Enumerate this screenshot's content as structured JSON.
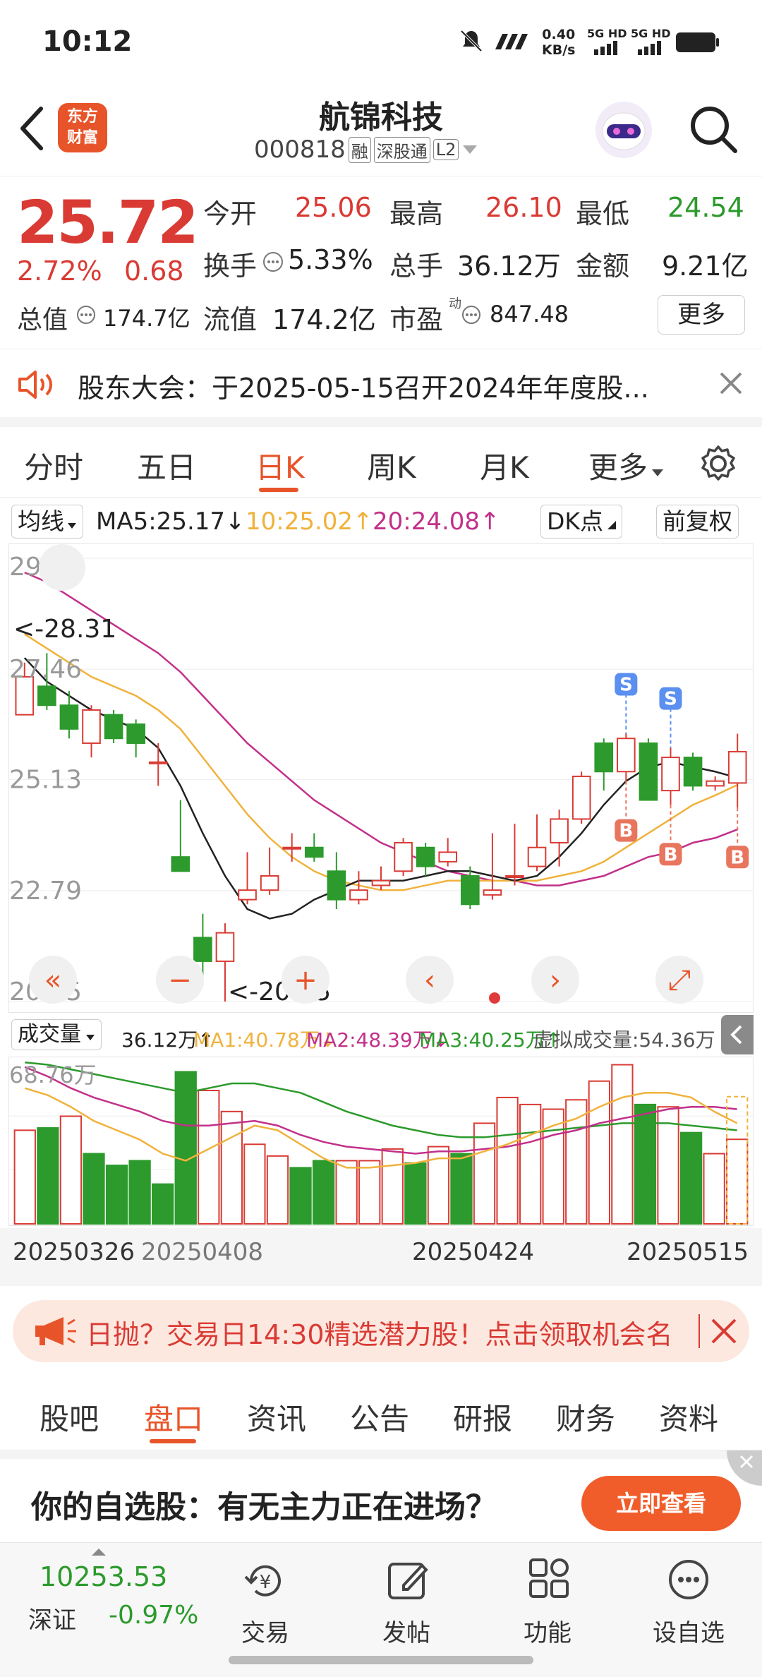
{
  "status": {
    "time": "10:12",
    "net_speed": "0.40",
    "net_unit": "KB/s",
    "sig1": "5G HD",
    "sig2": "5G HD"
  },
  "header": {
    "logo_line1": "东方",
    "logo_line2": "财富",
    "stock_name": "航锦科技",
    "stock_code": "000818",
    "tag1": "融",
    "tag2": "深股通",
    "tag3": "L2"
  },
  "quote": {
    "price": "25.72",
    "pct": "2.72%",
    "change": "0.68",
    "open_label": "今开",
    "open": "25.06",
    "high_label": "最高",
    "high": "26.10",
    "low_label": "最低",
    "low": "24.54",
    "turnover_label": "换手",
    "turnover": "5.33%",
    "volume_label": "总手",
    "volume": "36.12万",
    "amount_label": "金额",
    "amount": "9.21亿",
    "mcap_label": "总值",
    "mcap": "174.7亿",
    "float_label": "流值",
    "float": "174.2亿",
    "pe_label": "市盈",
    "pe_sup": "动",
    "pe": "847.48",
    "more": "更多"
  },
  "notice": {
    "text": "股东大会：于2025-05-15召开2024年年度股..."
  },
  "ktabs": [
    "分时",
    "五日",
    "日K",
    "周K",
    "月K",
    "更多"
  ],
  "ma": {
    "select": "均线",
    "ma5": "MA5:25.17",
    "ma10": "10:25.02",
    "ma20": "20:24.08",
    "dk": "DK点",
    "adjust": "前复权"
  },
  "colors": {
    "accent": "#e8542a",
    "up": "#d93b34",
    "down": "#2c9a2c",
    "ma5": "#222222",
    "ma10": "#f0b23c",
    "ma20": "#c2308a"
  },
  "chart_data": [
    {
      "type": "candlestick",
      "title": "日K",
      "y_ticks": [
        "29.80",
        "27.46",
        "25.13",
        "22.79",
        "20.45"
      ],
      "ylim": [
        20.45,
        29.8
      ],
      "annotations": [
        "<-28.31",
        "<-20.45"
      ],
      "x_labels": [
        "20250326",
        "20250408",
        "20250424",
        "20250515"
      ],
      "candles": [
        {
          "o": 26.5,
          "c": 27.3,
          "h": 27.6,
          "l": 26.5
        },
        {
          "o": 27.1,
          "c": 26.7,
          "h": 27.8,
          "l": 26.6
        },
        {
          "o": 26.7,
          "c": 26.2,
          "h": 27.0,
          "l": 26.0
        },
        {
          "o": 25.9,
          "c": 26.6,
          "h": 26.7,
          "l": 25.6
        },
        {
          "o": 26.5,
          "c": 26.0,
          "h": 26.6,
          "l": 25.9
        },
        {
          "o": 26.3,
          "c": 25.9,
          "h": 26.4,
          "l": 25.6
        },
        {
          "o": 25.5,
          "c": 25.5,
          "h": 25.9,
          "l": 25.0
        },
        {
          "o": 23.5,
          "c": 23.2,
          "h": 24.7,
          "l": 23.2
        },
        {
          "o": 21.8,
          "c": 21.3,
          "h": 22.3,
          "l": 20.8
        },
        {
          "o": 21.3,
          "c": 21.9,
          "h": 22.1,
          "l": 20.45
        },
        {
          "o": 22.6,
          "c": 22.8,
          "h": 23.6,
          "l": 22.5
        },
        {
          "o": 22.8,
          "c": 23.1,
          "h": 23.7,
          "l": 22.7
        },
        {
          "o": 23.7,
          "c": 23.7,
          "h": 24.0,
          "l": 23.4
        },
        {
          "o": 23.7,
          "c": 23.5,
          "h": 24.0,
          "l": 23.4
        },
        {
          "o": 23.2,
          "c": 22.6,
          "h": 23.6,
          "l": 22.4
        },
        {
          "o": 22.6,
          "c": 22.8,
          "h": 23.2,
          "l": 22.5
        },
        {
          "o": 22.9,
          "c": 23.0,
          "h": 23.3,
          "l": 22.8
        },
        {
          "o": 23.2,
          "c": 23.8,
          "h": 23.9,
          "l": 23.1
        },
        {
          "o": 23.7,
          "c": 23.3,
          "h": 23.8,
          "l": 23.1
        },
        {
          "o": 23.4,
          "c": 23.6,
          "h": 23.9,
          "l": 23.3
        },
        {
          "o": 23.1,
          "c": 22.5,
          "h": 23.3,
          "l": 22.4
        },
        {
          "o": 22.7,
          "c": 22.8,
          "h": 24.0,
          "l": 22.6
        },
        {
          "o": 23.1,
          "c": 23.1,
          "h": 24.2,
          "l": 22.9
        },
        {
          "o": 23.3,
          "c": 23.7,
          "h": 24.4,
          "l": 23.2
        },
        {
          "o": 23.8,
          "c": 24.3,
          "h": 24.5,
          "l": 23.3
        },
        {
          "o": 24.3,
          "c": 25.2,
          "h": 25.3,
          "l": 24.2
        },
        {
          "o": 25.9,
          "c": 25.3,
          "h": 26.0,
          "l": 24.9
        },
        {
          "o": 25.3,
          "c": 26.0,
          "h": 26.1,
          "l": 25.1
        },
        {
          "o": 25.9,
          "c": 24.7,
          "h": 26.0,
          "l": 24.7
        },
        {
          "o": 24.9,
          "c": 25.6,
          "h": 25.8,
          "l": 24.6
        },
        {
          "o": 25.6,
          "c": 25.0,
          "h": 25.7,
          "l": 24.9
        },
        {
          "o": 25.0,
          "c": 25.1,
          "h": 25.2,
          "l": 24.9
        },
        {
          "o": 25.06,
          "c": 25.72,
          "h": 26.1,
          "l": 24.54
        }
      ],
      "ma5": [
        27.7,
        27.2,
        26.9,
        26.6,
        26.4,
        26.2,
        25.8,
        25.0,
        24.0,
        23.1,
        22.4,
        22.2,
        22.3,
        22.6,
        22.8,
        23.0,
        23.0,
        23.0,
        23.1,
        23.2,
        23.2,
        23.1,
        23.0,
        23.1,
        23.5,
        24.0,
        24.6,
        25.1,
        25.4,
        25.5,
        25.4,
        25.3,
        25.17
      ],
      "ma10": [
        28.2,
        27.9,
        27.6,
        27.3,
        27.1,
        26.9,
        26.6,
        26.2,
        25.6,
        25.0,
        24.4,
        23.9,
        23.5,
        23.2,
        23.0,
        22.9,
        22.8,
        22.8,
        22.9,
        23.0,
        23.0,
        23.0,
        23.0,
        23.0,
        23.1,
        23.2,
        23.4,
        23.7,
        24.0,
        24.3,
        24.6,
        24.8,
        25.02
      ],
      "ma20": [
        29.5,
        29.3,
        29.0,
        28.7,
        28.4,
        28.1,
        27.8,
        27.4,
        26.9,
        26.4,
        25.9,
        25.5,
        25.1,
        24.7,
        24.4,
        24.1,
        23.8,
        23.6,
        23.4,
        23.2,
        23.1,
        23.0,
        23.0,
        22.9,
        22.9,
        23.0,
        23.1,
        23.3,
        23.5,
        23.6,
        23.8,
        23.9,
        24.08
      ],
      "signals": [
        {
          "i": 27,
          "type": "S"
        },
        {
          "i": 29,
          "type": "S"
        },
        {
          "i": 27,
          "type": "B"
        },
        {
          "i": 29,
          "type": "B"
        },
        {
          "i": 32,
          "type": "B"
        }
      ]
    },
    {
      "type": "bar",
      "title": "成交量",
      "y_top_label": "68.76万",
      "ylim": [
        0,
        68.76
      ],
      "values": [
        40,
        41,
        46,
        30,
        25,
        27,
        17,
        65,
        57,
        48,
        34,
        29,
        24,
        27,
        27,
        27,
        32,
        26,
        33,
        30,
        43,
        54,
        51,
        49,
        53,
        61,
        68,
        51,
        50,
        39,
        30,
        36.12
      ],
      "up": [
        true,
        false,
        true,
        false,
        false,
        false,
        false,
        false,
        true,
        true,
        true,
        true,
        false,
        false,
        true,
        true,
        true,
        false,
        true,
        false,
        true,
        true,
        true,
        true,
        true,
        true,
        true,
        false,
        true,
        false,
        true,
        true
      ],
      "ma1": [
        58,
        55,
        50,
        44,
        40,
        36,
        30,
        27,
        32,
        37,
        42,
        40,
        34,
        28,
        24,
        24,
        25,
        26,
        28,
        28,
        31,
        34,
        38,
        42,
        45,
        50,
        54,
        56,
        56,
        54,
        48,
        43
      ],
      "ma2": [
        67,
        63,
        58,
        54,
        51,
        48,
        44,
        42,
        42,
        43,
        44,
        42,
        38,
        35,
        33,
        32,
        31,
        30,
        31,
        31,
        32,
        33,
        35,
        38,
        40,
        43,
        45,
        47,
        49,
        50,
        50,
        49
      ],
      "ma3": [
        69,
        68,
        66,
        64,
        62,
        60,
        58,
        56,
        58,
        60,
        60,
        58,
        56,
        52,
        48,
        45,
        42,
        40,
        38,
        37,
        37,
        38,
        39,
        40,
        41,
        42,
        43,
        43,
        43,
        42,
        41,
        40
      ]
    }
  ],
  "vol": {
    "select": "成交量",
    "vol": "36.12万",
    "ma1": "MA1:40.78万",
    "ma2": "MA2:48.39万",
    "ma3": "MA3:40.25万",
    "virtual": "虚拟成交量:54.36万"
  },
  "banner": {
    "text": "日抛？交易日14:30精选潜力股！点击领取机会名"
  },
  "btabs": [
    "股吧",
    "盘口",
    "资讯",
    "公告",
    "研报",
    "财务",
    "资料"
  ],
  "promo": {
    "text": "你的自选股：有无主力正在进场？",
    "button": "立即查看"
  },
  "index": {
    "value": "10253.53",
    "name": "深证",
    "pct": "-0.97%"
  },
  "nav": [
    "交易",
    "发帖",
    "功能",
    "设自选"
  ]
}
